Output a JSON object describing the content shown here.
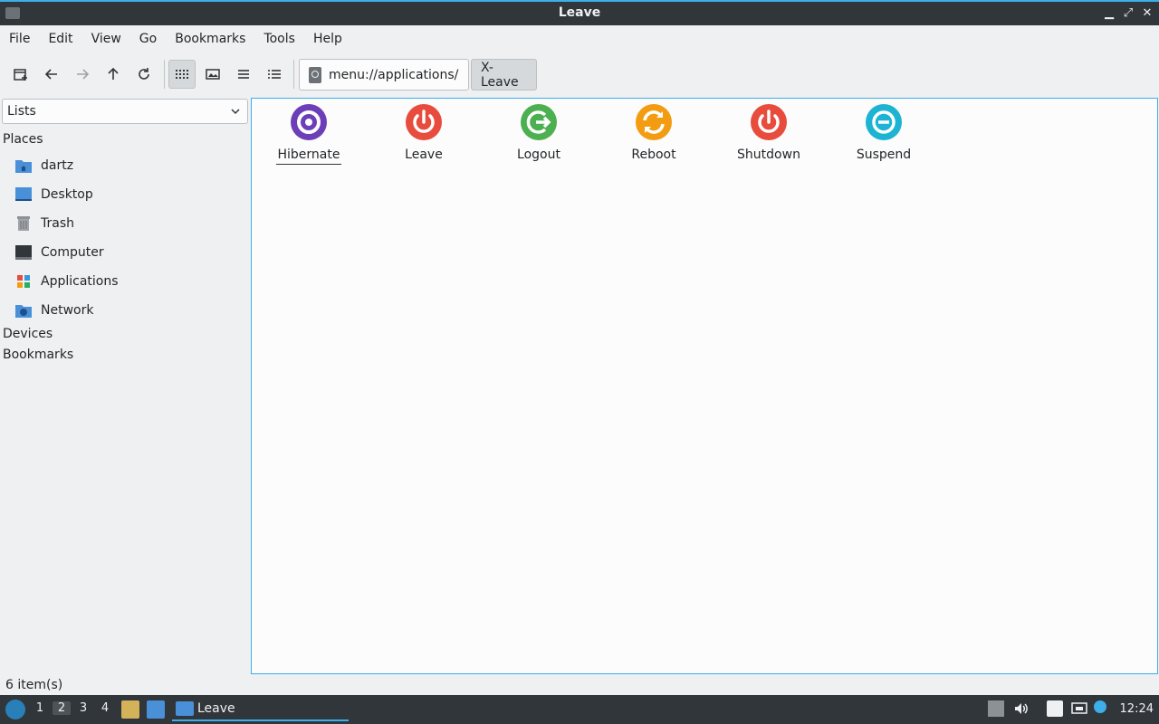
{
  "window": {
    "title": "Leave",
    "minimize_glyph": "▁",
    "maximize_glyph": "⤢",
    "close_glyph": "✕"
  },
  "menubar": {
    "items": [
      "File",
      "Edit",
      "View",
      "Go",
      "Bookmarks",
      "Tools",
      "Help"
    ]
  },
  "toolbar": {
    "buttons": [
      "new-tab-icon",
      "back-arrow-icon",
      "forward-arrow-icon",
      "up-arrow-icon",
      "reload-icon",
      "icon-view-icon",
      "thumbnail-view-icon",
      "compact-view-icon",
      "detailed-list-view-icon"
    ],
    "location": "menu://applications/",
    "breadcrumb": "X-Leave"
  },
  "sidebar": {
    "mode": "Lists",
    "places_heading": "Places",
    "places": [
      {
        "label": "dartz",
        "icon": "home-folder-icon"
      },
      {
        "label": "Desktop",
        "icon": "desktop-icon"
      },
      {
        "label": "Trash",
        "icon": "trash-icon"
      },
      {
        "label": "Computer",
        "icon": "computer-icon"
      },
      {
        "label": "Applications",
        "icon": "applications-icon"
      },
      {
        "label": "Network",
        "icon": "network-folder-icon"
      }
    ],
    "devices_heading": "Devices",
    "bookmarks_heading": "Bookmarks"
  },
  "main": {
    "items": [
      {
        "label": "Hibernate",
        "icon": "hibernate-icon",
        "color": "#6c3eb8"
      },
      {
        "label": "Leave",
        "icon": "leave-icon",
        "color": "#e74c3c"
      },
      {
        "label": "Logout",
        "icon": "logout-icon",
        "color": "#4caf50"
      },
      {
        "label": "Reboot",
        "icon": "reboot-icon",
        "color": "#f39c12"
      },
      {
        "label": "Shutdown",
        "icon": "shutdown-icon",
        "color": "#e74c3c"
      },
      {
        "label": "Suspend",
        "icon": "suspend-icon",
        "color": "#1cb4d2"
      }
    ]
  },
  "status": {
    "text": "6 item(s)"
  },
  "taskbar": {
    "workspaces": [
      "1",
      "2",
      "3",
      "4"
    ],
    "active_task": "Leave",
    "clock": "12:24"
  },
  "colors": {
    "accent": "#3daee9",
    "titlebar": "#31363b",
    "window_bg": "#eff0f1"
  }
}
